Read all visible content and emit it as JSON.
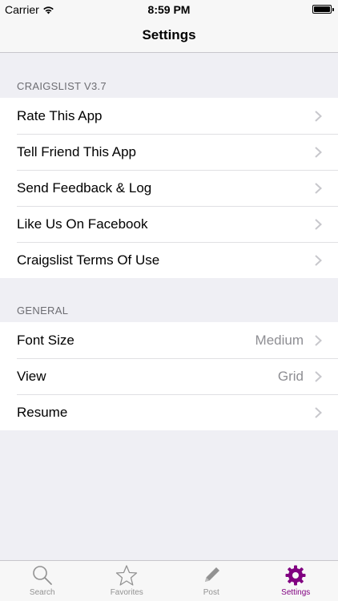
{
  "status": {
    "carrier": "Carrier",
    "time": "8:59 PM"
  },
  "nav": {
    "title": "Settings"
  },
  "sections": [
    {
      "header": "CRAIGSLIST V3.7",
      "rows": [
        {
          "label": "Rate This App"
        },
        {
          "label": "Tell Friend This App"
        },
        {
          "label": "Send Feedback & Log"
        },
        {
          "label": "Like Us On Facebook"
        },
        {
          "label": "Craigslist Terms Of Use"
        }
      ]
    },
    {
      "header": "GENERAL",
      "rows": [
        {
          "label": "Font Size",
          "value": "Medium"
        },
        {
          "label": "View",
          "value": "Grid"
        },
        {
          "label": "Resume"
        }
      ]
    }
  ],
  "tabs": [
    {
      "label": "Search",
      "icon": "search-icon"
    },
    {
      "label": "Favorites",
      "icon": "star-icon"
    },
    {
      "label": "Post",
      "icon": "pencil-icon"
    },
    {
      "label": "Settings",
      "icon": "gear-icon",
      "active": true
    }
  ],
  "colors": {
    "accent": "#800080",
    "inactive": "#929292",
    "background": "#efeff4"
  }
}
